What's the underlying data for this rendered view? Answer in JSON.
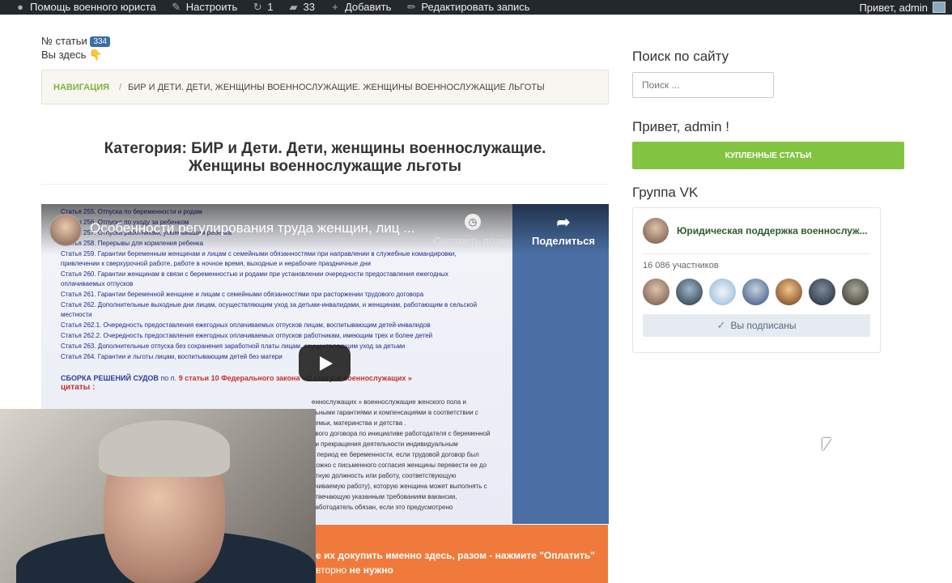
{
  "admin_bar": {
    "site": "Помощь военного юриста",
    "customize": "Настроить",
    "updates": "1",
    "comments": "33",
    "add": "Добавить",
    "edit": "Редактировать запись",
    "greeting": "Привет, admin"
  },
  "article": {
    "num_label": "№ статьи",
    "num": "334",
    "you_are_here": "Вы здесь",
    "breadcrumb": {
      "nav": "Навигация",
      "sep": "/",
      "current": "БИР и Дети. Дети, женщины военнослужащие. Женщины военнослужащие льготы"
    },
    "category_title": "Категория: БИР и Дети. Дети, женщины военнослужащие. Женщины военнослужащие льготы"
  },
  "video": {
    "title": "Особенности регулирования труда женщин, лиц ...",
    "watch_later": "Смотреть позже",
    "share": "Поделиться",
    "doc_lines": [
      "Статья 255. Отпуска по беременности и родам",
      "Статья 256. Отпуска по уходу за ребенком",
      "Статья 257. Отпуска работникам, усыновившим ребенка",
      "Статья 258. Перерывы для кормления ребенка",
      "Статья 259. Гарантии беременным женщинам и лицам с семейными обязанностями при направлении в служебные командировки, привлечении к сверхурочной работе, работе в ночное время, выходные и нерабочие праздничные дни",
      "Статья 260. Гарантии женщинам в связи с беременностью и родами при установлении очередности предоставления ежегодных оплачиваемых отпусков",
      "Статья 261. Гарантии беременной женщине и лицам с семейными обязанностями при расторжении трудового договора",
      "Статья 262. Дополнительные выходные дни лицам, осуществляющим уход за детьми-инвалидами, и женщинам, работающим в сельской местности",
      "Статья 262.1. Очередность предоставления ежегодных оплачиваемых отпусков лицам, воспитывающим детей-инвалидов",
      "Статья 262.2. Очередность предоставления ежегодных оплачиваемых отпусков работникам, имеющим трех и более детей",
      "Статья 263. Дополнительные отпуска без сохранения заработной платы лицам, осуществляющим уход за детьми",
      "Статья 264. Гарантии и льготы лицам, воспитывающим детей без матери"
    ],
    "collection_a": "СБОРКА РЕШЕНИЙ СУДОВ",
    "collection_b": "по п.",
    "collection_c": "9 статьи 10 Федерального закона «О статусе военнослужащих »",
    "quotes": "цитаты :",
    "quote_lines": [
      "еннослужащих » военнослужащие женского пола и",
      "льными гарантиями и компенсациями в соответствии с",
      "семьи, материнства и детства .",
      "ового договора по инициативе работодателя с беременной",
      "ии прекращения деятельности индивидуальным",
      "в период ее беременности, если трудовой договор был",
      "можно с письменного согласия женщины перевести ее до",
      "нтную должность или работу, соответствующую",
      "ачиваемую работу), которую женщина может выполнять с",
      "отвечающую указанным требованиям вакансии,",
      "работодатель обязан, если это предусмотрено"
    ]
  },
  "promo": {
    "line1": "е их докупить именно здесь, разом - нажмите \"Оплатить\"",
    "line2a": "вторно ",
    "line2b": "не нужно"
  },
  "sidebar": {
    "search_title": "Поиск по сайту",
    "search_placeholder": "Поиск ...",
    "greeting": "Привет, admin !",
    "purchased_button": "Купленные статьи",
    "vk_title": "Группа VK",
    "vk_group_name": "Юридическая поддержка военнослуж...",
    "vk_members": "16 086 участников",
    "vk_subscribed": "Вы подписаны"
  },
  "colors": {
    "admin_bar": "#23282d",
    "accent_green": "#82c341",
    "promo_orange": "#ef7a3c",
    "badge_blue": "#3a6ea5"
  }
}
